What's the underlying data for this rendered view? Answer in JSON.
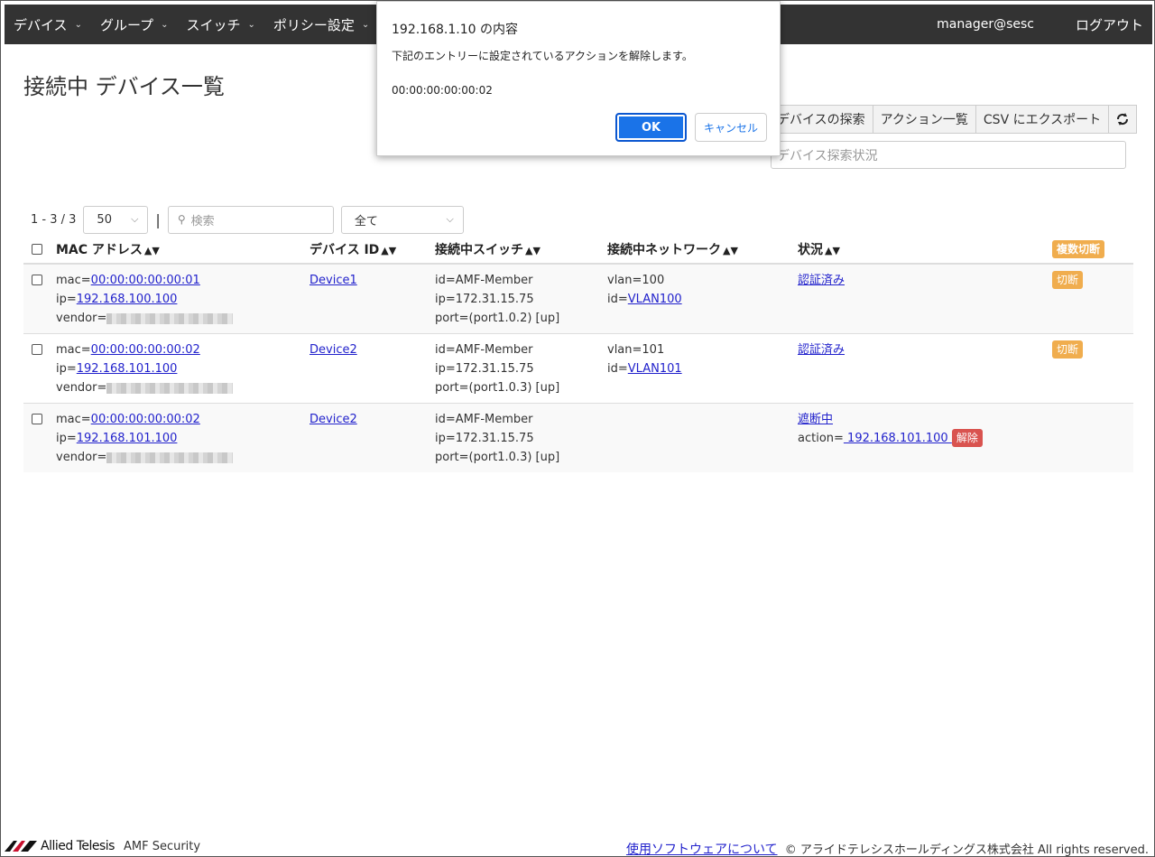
{
  "nav": {
    "items": [
      {
        "label": "デバイス"
      },
      {
        "label": "グループ"
      },
      {
        "label": "スイッチ"
      },
      {
        "label": "ポリシー設定"
      }
    ],
    "user": "manager@sesc",
    "logout": "ログアウト"
  },
  "page": {
    "title": "接続中 デバイス一覧"
  },
  "toolbar": {
    "discover": "デバイスの探索",
    "actions": "アクション一覧",
    "export": "CSV にエクスポート",
    "refresh_icon": "refresh-icon",
    "status_placeholder": "デバイス探索状況"
  },
  "pager": {
    "count": "1 - 3 / 3",
    "page_size": "50",
    "separator": "|",
    "search_placeholder": "検索",
    "filter": "全て"
  },
  "table": {
    "headers": {
      "mac": "MAC アドレス",
      "device": "デバイス ID",
      "switch": "接続中スイッチ",
      "network": "接続中ネットワーク",
      "status": "状況",
      "bulk": "複数切断"
    },
    "rows": [
      {
        "mac_label": "mac=",
        "mac": "00:00:00:00:00:01",
        "ip_label": "ip=",
        "ip": "192.168.100.100",
        "vendor_label": "vendor=",
        "device": "Device1",
        "sw_id": "id=AMF-Member",
        "sw_ip": "ip=172.31.15.75",
        "sw_port": "port=(port1.0.2) [up]",
        "vlan": "vlan=100",
        "net_id_label": "id=",
        "net_id": "VLAN100",
        "status": "認証済み",
        "action_label": "",
        "action": "",
        "action_badge": "",
        "disconnect": "切断"
      },
      {
        "mac_label": "mac=",
        "mac": "00:00:00:00:00:02",
        "ip_label": "ip=",
        "ip": "192.168.101.100",
        "vendor_label": "vendor=",
        "device": "Device2",
        "sw_id": "id=AMF-Member",
        "sw_ip": "ip=172.31.15.75",
        "sw_port": "port=(port1.0.3) [up]",
        "vlan": "vlan=101",
        "net_id_label": "id=",
        "net_id": "VLAN101",
        "status": "認証済み",
        "action_label": "",
        "action": "",
        "action_badge": "",
        "disconnect": "切断"
      },
      {
        "mac_label": "mac=",
        "mac": "00:00:00:00:00:02",
        "ip_label": "ip=",
        "ip": "192.168.101.100",
        "vendor_label": "vendor=",
        "device": "Device2",
        "sw_id": "id=AMF-Member",
        "sw_ip": "ip=172.31.15.75",
        "sw_port": "port=(port1.0.3) [up]",
        "vlan": "",
        "net_id_label": "",
        "net_id": "",
        "status": "遮断中",
        "action_label": "action=",
        "action": " 192.168.101.100 ",
        "action_badge": "解除",
        "disconnect": ""
      }
    ]
  },
  "footer": {
    "brand": "Allied Telesis",
    "product": "AMF Security",
    "about_link": "使用ソフトウェアについて",
    "copyright": "© アライドテレシスホールディングス株式会社 All rights reserved."
  },
  "dialog": {
    "title": "192.168.1.10 の内容",
    "message": "下記のエントリーに設定されているアクションを解除します。",
    "mac": "00:00:00:00:00:02",
    "ok": "OK",
    "cancel": "キャンセル"
  },
  "colors": {
    "navbar": "#333333",
    "warning": "#f0ad4e",
    "danger": "#d9534f",
    "primary": "#1a73e8"
  }
}
